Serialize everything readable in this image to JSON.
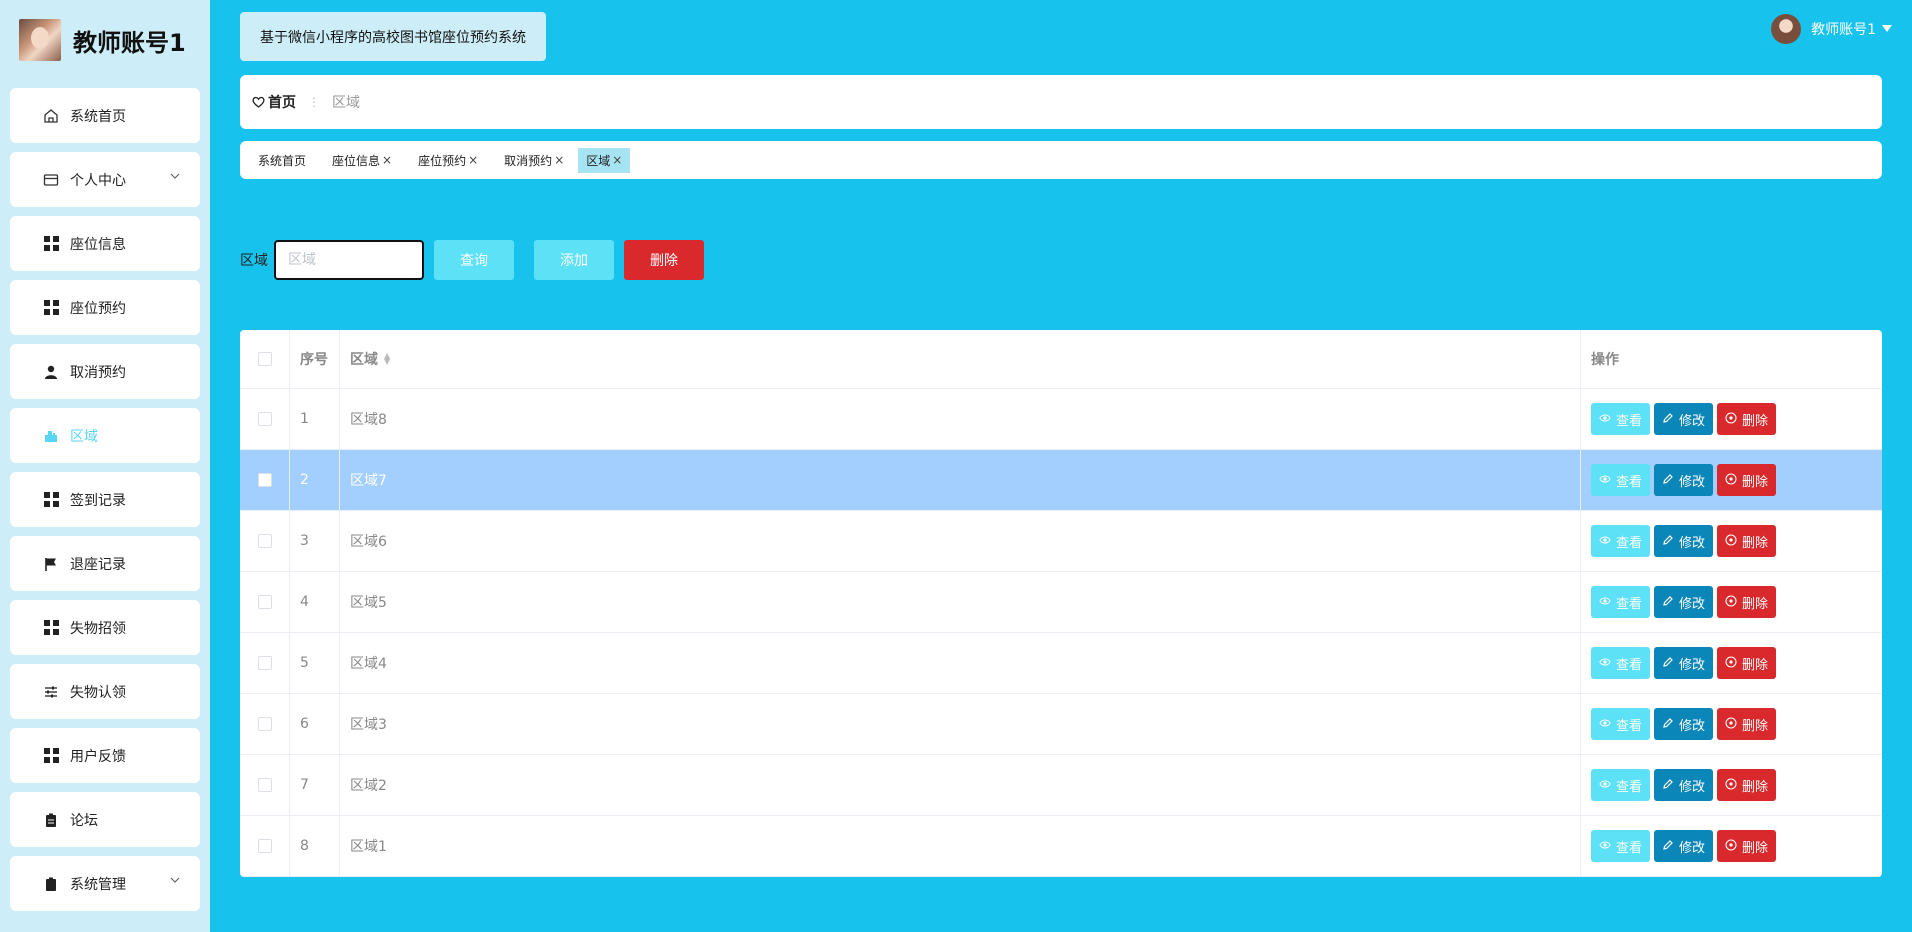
{
  "brand": {
    "title": "教师账号1"
  },
  "menu": [
    {
      "label": "系统首页",
      "icon": "home-icon"
    },
    {
      "label": "个人中心",
      "icon": "wallet-icon"
    },
    {
      "label": "座位信息",
      "icon": "grid-icon"
    },
    {
      "label": "座位预约",
      "icon": "grid-icon"
    },
    {
      "label": "取消预约",
      "icon": "user-icon"
    },
    {
      "label": "区域",
      "icon": "building-icon"
    },
    {
      "label": "签到记录",
      "icon": "grid-icon"
    },
    {
      "label": "退座记录",
      "icon": "flag-icon"
    },
    {
      "label": "失物招领",
      "icon": "grid-icon"
    },
    {
      "label": "失物认领",
      "icon": "sliders-icon"
    },
    {
      "label": "用户反馈",
      "icon": "grid-icon"
    },
    {
      "label": "论坛",
      "icon": "clipboard-icon"
    },
    {
      "label": "系统管理",
      "icon": "clipboard-icon"
    }
  ],
  "header": {
    "system_title": "基于微信小程序的高校图书馆座位预约系统",
    "username": "教师账号1"
  },
  "breadcrumb": {
    "home": "首页",
    "current": "区域"
  },
  "tags": [
    {
      "label": "系统首页",
      "closable": false
    },
    {
      "label": "座位信息",
      "closable": true
    },
    {
      "label": "座位预约",
      "closable": true
    },
    {
      "label": "取消预约",
      "closable": true
    },
    {
      "label": "区域",
      "closable": true
    }
  ],
  "search": {
    "label": "区域",
    "placeholder": "区域",
    "query": "查询",
    "add": "添加",
    "delete": "删除"
  },
  "table": {
    "headers": {
      "index": "序号",
      "area": "区域",
      "ops": "操作"
    },
    "ops": {
      "view": "查看",
      "edit": "修改",
      "delete": "删除"
    },
    "rows": [
      {
        "index": "1",
        "area": "区域8"
      },
      {
        "index": "2",
        "area": "区域7"
      },
      {
        "index": "3",
        "area": "区域6"
      },
      {
        "index": "4",
        "area": "区域5"
      },
      {
        "index": "5",
        "area": "区域4"
      },
      {
        "index": "6",
        "area": "区域3"
      },
      {
        "index": "7",
        "area": "区域2"
      },
      {
        "index": "8",
        "area": "区域1"
      }
    ]
  },
  "colors": {
    "page_bg": "#17c2ec",
    "sidebar_bg": "#cdeef8",
    "accent": "#5ce1f6",
    "danger": "#d9292c",
    "edit": "#0a86b8",
    "selected_row": "#a3cfff"
  }
}
